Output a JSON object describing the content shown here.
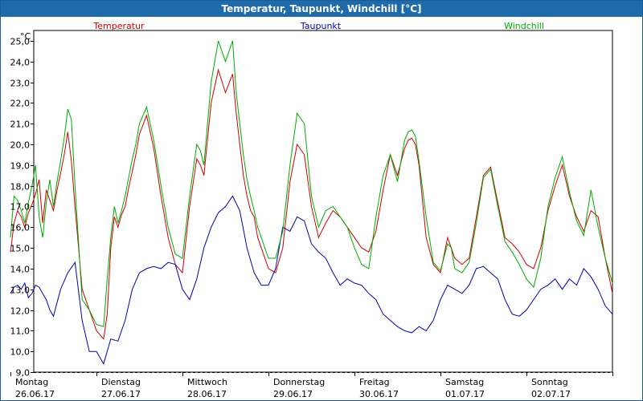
{
  "window": {
    "title": "Temperatur, Taupunkt, Windchill [°C]"
  },
  "chart_data": {
    "type": "line",
    "y_unit": "°C",
    "ylim": [
      9.0,
      25.5
    ],
    "y_ticks": [
      9.0,
      10.0,
      11.0,
      12.0,
      13.0,
      14.0,
      15.0,
      16.0,
      17.0,
      18.0,
      19.0,
      20.0,
      21.0,
      22.0,
      23.0,
      24.0,
      25.0
    ],
    "y_tick_labels": [
      "9,0",
      "10,0",
      "11,0",
      "12,0",
      "13,0",
      "14,0",
      "15,0",
      "16,0",
      "17,0",
      "18,0",
      "19,0",
      "20,0",
      "21,0",
      "22,0",
      "23,0",
      "24,0",
      "25,0"
    ],
    "x_range_hours": [
      0,
      168
    ],
    "day_ticks": [
      0,
      24,
      48,
      72,
      96,
      120,
      144,
      168
    ],
    "days": [
      {
        "weekday": "Montag",
        "date": "26.06.17"
      },
      {
        "weekday": "Dienstag",
        "date": "27.06.17"
      },
      {
        "weekday": "Mittwoch",
        "date": "28.06.17"
      },
      {
        "weekday": "Donnerstag",
        "date": "29.06.17"
      },
      {
        "weekday": "Freitag",
        "date": "30.06.17"
      },
      {
        "weekday": "Samstag",
        "date": "01.07.17"
      },
      {
        "weekday": "Sonntag",
        "date": "02.07.17"
      }
    ],
    "grid": true,
    "grid_x_hours": [
      24,
      48,
      72,
      96,
      120,
      144
    ],
    "series": [
      {
        "name": "Temperatur",
        "color": "#cc0000",
        "x": [
          0,
          1,
          2,
          3,
          4,
          5,
          6,
          7,
          8,
          9,
          10,
          11,
          12,
          13,
          14,
          15,
          16,
          17,
          18,
          20,
          22,
          24,
          26,
          27,
          28,
          29,
          30,
          31,
          32,
          33,
          34,
          35,
          36,
          38,
          40,
          42,
          44,
          46,
          48,
          50,
          52,
          53,
          54,
          56,
          58,
          60,
          62,
          63,
          64,
          65,
          66,
          67,
          68,
          69,
          70,
          72,
          74,
          76,
          78,
          80,
          82,
          84,
          86,
          88,
          90,
          92,
          94,
          96,
          98,
          100,
          102,
          104,
          106,
          108,
          110,
          111,
          112,
          113,
          114,
          116,
          118,
          120,
          122,
          123,
          124,
          126,
          128,
          130,
          132,
          134,
          136,
          138,
          140,
          142,
          144,
          146,
          148,
          150,
          152,
          154,
          156,
          158,
          160,
          162,
          164,
          166,
          168
        ],
        "y": [
          14.8,
          16.2,
          16.8,
          16.5,
          16.0,
          16.7,
          17.1,
          17.6,
          18.3,
          16.2,
          17.8,
          17.3,
          16.8,
          17.8,
          18.6,
          19.5,
          20.6,
          19.2,
          17.0,
          13.0,
          12.0,
          11.0,
          10.6,
          11.8,
          15.0,
          16.5,
          16.0,
          16.6,
          17.0,
          17.9,
          18.7,
          19.5,
          20.5,
          21.4,
          19.8,
          17.5,
          15.5,
          14.2,
          13.8,
          17.0,
          19.3,
          19.0,
          18.5,
          22.0,
          23.6,
          22.5,
          23.4,
          21.5,
          20.0,
          18.5,
          17.5,
          16.8,
          16.5,
          15.5,
          15.0,
          14.0,
          13.8,
          15.0,
          18.2,
          20.0,
          19.5,
          17.0,
          15.5,
          16.2,
          16.8,
          16.5,
          16.0,
          15.5,
          15.0,
          14.8,
          15.8,
          17.8,
          19.5,
          18.5,
          19.8,
          20.2,
          20.3,
          20.0,
          19.0,
          15.5,
          14.2,
          13.8,
          15.5,
          15.0,
          14.5,
          14.2,
          14.5,
          16.5,
          18.5,
          18.9,
          17.2,
          15.5,
          15.2,
          14.8,
          14.2,
          14.0,
          15.0,
          16.8,
          18.0,
          19.0,
          17.5,
          16.5,
          15.8,
          16.8,
          16.5,
          14.5,
          12.8
        ]
      },
      {
        "name": "Taupunkt",
        "color": "#0000aa",
        "x": [
          0,
          1,
          2,
          3,
          4,
          5,
          6,
          7,
          8,
          9,
          10,
          11,
          12,
          14,
          16,
          18,
          20,
          22,
          24,
          26,
          28,
          30,
          32,
          34,
          36,
          38,
          40,
          42,
          44,
          46,
          48,
          50,
          52,
          54,
          56,
          58,
          60,
          62,
          64,
          66,
          68,
          70,
          72,
          74,
          76,
          78,
          80,
          82,
          84,
          86,
          88,
          90,
          92,
          94,
          96,
          98,
          100,
          102,
          104,
          106,
          108,
          110,
          112,
          114,
          116,
          118,
          120,
          122,
          124,
          126,
          128,
          130,
          132,
          134,
          136,
          138,
          140,
          142,
          144,
          146,
          148,
          150,
          152,
          154,
          156,
          158,
          160,
          162,
          164,
          166,
          168
        ],
        "y": [
          12.8,
          13.1,
          13.2,
          13.0,
          13.3,
          12.6,
          12.8,
          13.2,
          13.1,
          12.8,
          12.5,
          12.0,
          11.7,
          13.0,
          13.8,
          14.3,
          11.5,
          10.0,
          10.0,
          9.4,
          10.6,
          10.5,
          11.5,
          13.0,
          13.8,
          14.0,
          14.1,
          14.0,
          14.3,
          14.2,
          13.0,
          12.5,
          13.5,
          15.0,
          16.0,
          16.7,
          17.0,
          17.5,
          16.8,
          15.0,
          13.8,
          13.2,
          13.2,
          14.0,
          16.0,
          15.8,
          16.5,
          16.3,
          15.2,
          14.8,
          14.5,
          13.8,
          13.2,
          13.5,
          13.3,
          13.2,
          12.8,
          12.5,
          11.8,
          11.5,
          11.2,
          11.0,
          10.9,
          11.2,
          11.0,
          11.5,
          12.5,
          13.2,
          13.0,
          12.8,
          13.2,
          14.0,
          14.1,
          13.8,
          13.5,
          12.5,
          11.8,
          11.7,
          12.0,
          12.5,
          13.0,
          13.2,
          13.5,
          13.0,
          13.5,
          13.2,
          14.0,
          13.6,
          13.0,
          12.2,
          11.8
        ]
      },
      {
        "name": "Windchill",
        "color": "#00aa00",
        "x": [
          0,
          1,
          2,
          3,
          4,
          5,
          6,
          7,
          8,
          9,
          10,
          11,
          12,
          13,
          14,
          15,
          16,
          17,
          18,
          20,
          22,
          24,
          26,
          27,
          28,
          29,
          30,
          31,
          32,
          33,
          34,
          35,
          36,
          38,
          40,
          42,
          44,
          46,
          48,
          50,
          52,
          53,
          54,
          56,
          58,
          60,
          62,
          63,
          64,
          65,
          66,
          67,
          68,
          69,
          70,
          72,
          74,
          76,
          78,
          80,
          82,
          84,
          86,
          88,
          90,
          92,
          94,
          96,
          98,
          100,
          102,
          104,
          106,
          108,
          110,
          111,
          112,
          113,
          114,
          116,
          118,
          120,
          122,
          123,
          124,
          126,
          128,
          130,
          132,
          134,
          136,
          138,
          140,
          142,
          144,
          146,
          148,
          150,
          152,
          154,
          156,
          158,
          160,
          162,
          164,
          166,
          168
        ],
        "y": [
          15.5,
          17.5,
          17.3,
          16.8,
          16.2,
          17.2,
          18.0,
          19.0,
          16.5,
          15.5,
          17.2,
          18.3,
          17.0,
          18.2,
          19.2,
          20.3,
          21.7,
          21.2,
          18.0,
          12.5,
          12.0,
          11.3,
          11.2,
          13.5,
          15.5,
          17.0,
          16.2,
          16.8,
          17.5,
          18.4,
          19.3,
          20.0,
          21.0,
          21.8,
          20.2,
          18.0,
          16.0,
          14.7,
          14.5,
          17.5,
          20.0,
          19.7,
          19.0,
          23.0,
          25.0,
          24.0,
          25.0,
          22.5,
          21.0,
          19.5,
          18.3,
          17.5,
          16.8,
          16.0,
          15.5,
          14.5,
          14.5,
          15.8,
          19.0,
          21.5,
          21.0,
          17.5,
          16.0,
          16.8,
          17.0,
          16.5,
          16.0,
          15.0,
          14.2,
          14.0,
          16.5,
          18.5,
          19.5,
          18.2,
          20.2,
          20.6,
          20.7,
          20.4,
          19.2,
          16.5,
          14.3,
          13.9,
          15.2,
          15.0,
          14.0,
          13.8,
          14.3,
          16.2,
          18.4,
          18.8,
          17.0,
          15.3,
          14.8,
          14.2,
          13.5,
          13.1,
          14.5,
          17.0,
          18.4,
          19.4,
          17.7,
          16.3,
          15.6,
          17.8,
          16.0,
          14.5,
          13.3
        ]
      }
    ]
  }
}
